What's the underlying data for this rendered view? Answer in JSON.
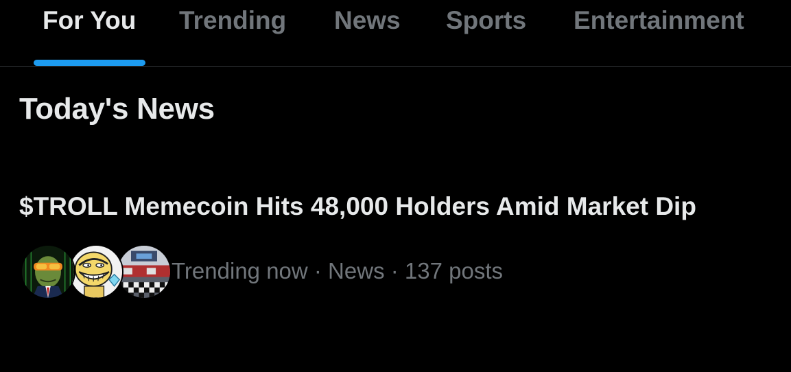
{
  "tabs": [
    {
      "label": "For You",
      "active": true
    },
    {
      "label": "Trending",
      "active": false
    },
    {
      "label": "News",
      "active": false
    },
    {
      "label": "Sports",
      "active": false
    },
    {
      "label": "Entertainment",
      "active": false
    }
  ],
  "section": {
    "title": "Today's News"
  },
  "trend": {
    "headline": "$TROLL Memecoin Hits 48,000 Holders Amid Market Dip",
    "meta": "Trending now · News · 137 posts",
    "avatars": [
      "frog-avatar",
      "troll-face-avatar",
      "race-scene-avatar"
    ]
  },
  "colors": {
    "background": "#000000",
    "text_primary": "#e7e9ea",
    "text_secondary": "#71767b",
    "accent": "#1d9bf0",
    "divider": "#2f3336"
  }
}
